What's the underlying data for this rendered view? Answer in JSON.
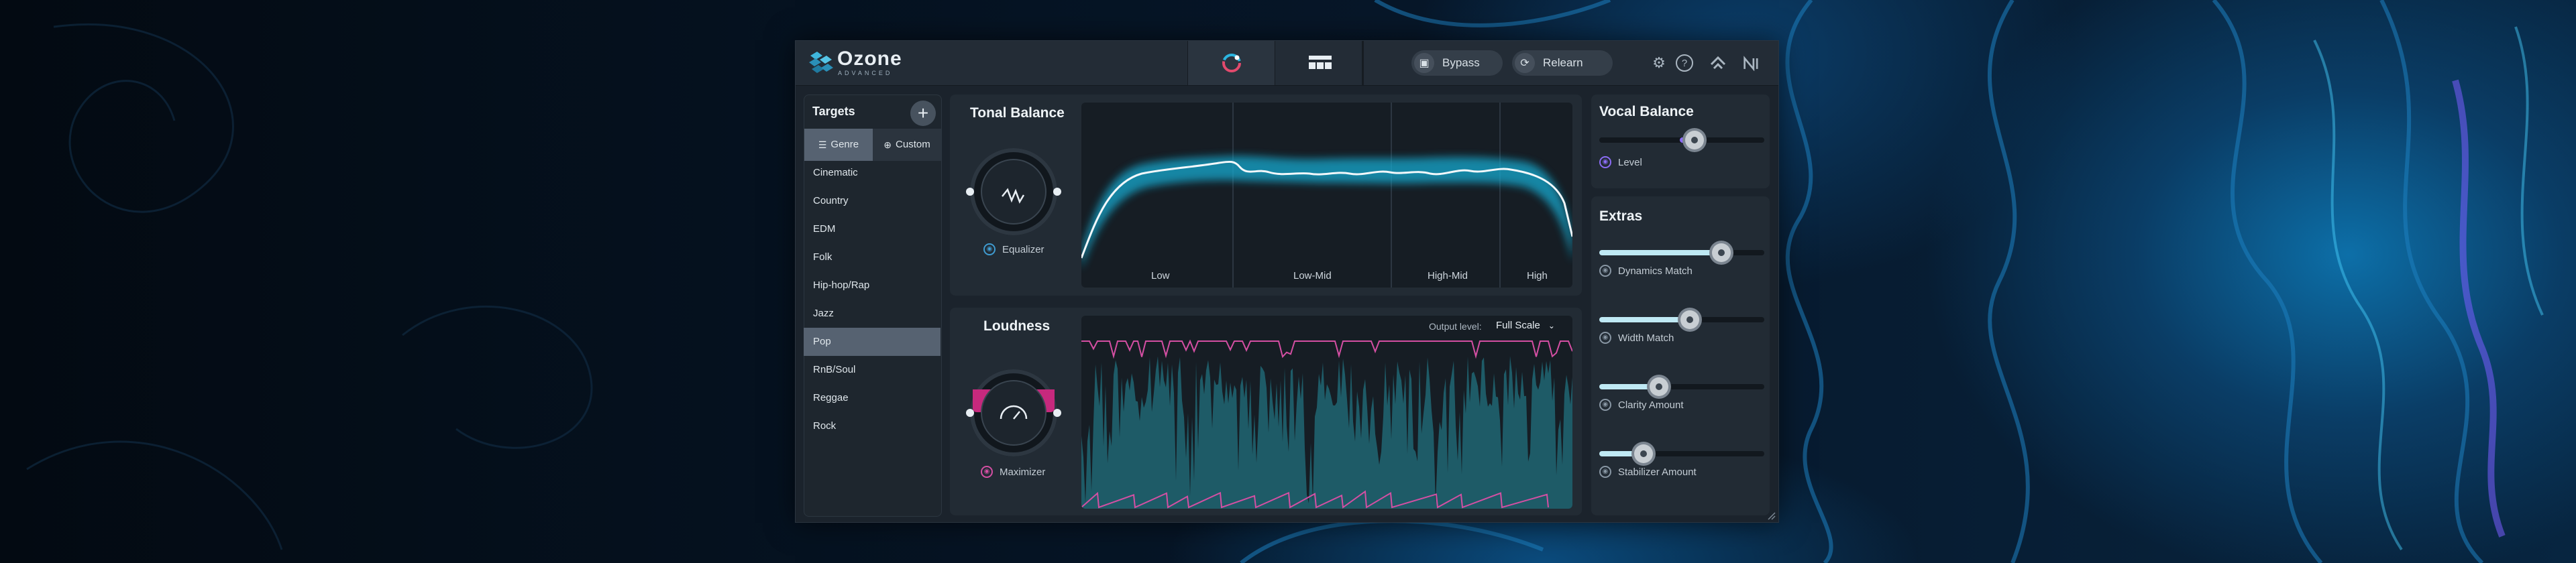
{
  "app": {
    "logo": "Ozone",
    "edition": "ADVANCED"
  },
  "toolbar": {
    "bypass_label": "Bypass",
    "relearn_label": "Relearn"
  },
  "targets": {
    "title": "Targets",
    "tabs": [
      {
        "label": "Genre",
        "selected": true
      },
      {
        "label": "Custom",
        "selected": false
      }
    ],
    "items": [
      "Cinematic",
      "Country",
      "EDM",
      "Folk",
      "Hip-hop/Rap",
      "Jazz",
      "Pop",
      "RnB/Soul",
      "Reggae",
      "Rock"
    ],
    "selected": "Pop"
  },
  "tonal_balance": {
    "title": "Tonal Balance",
    "knob_label": "Equalizer",
    "bands": [
      "Low",
      "Low-Mid",
      "High-Mid",
      "High"
    ]
  },
  "loudness": {
    "title": "Loudness",
    "knob_label": "Maximizer",
    "output_level_label": "Output level:",
    "output_level_value": "Full Scale"
  },
  "vocal_balance": {
    "title": "Vocal Balance",
    "level_label": "Level",
    "level": 0.55
  },
  "extras": {
    "title": "Extras",
    "sliders": [
      {
        "label": "Dynamics Match",
        "value": 0.74
      },
      {
        "label": "Width Match",
        "value": 0.55
      },
      {
        "label": "Clarity Amount",
        "value": 0.36
      },
      {
        "label": "Stabilizer Amount",
        "value": 0.27
      }
    ]
  },
  "colors": {
    "accent_teal": "#16b6da",
    "accent_pink": "#d44fa3",
    "bg": "#1b232c"
  }
}
